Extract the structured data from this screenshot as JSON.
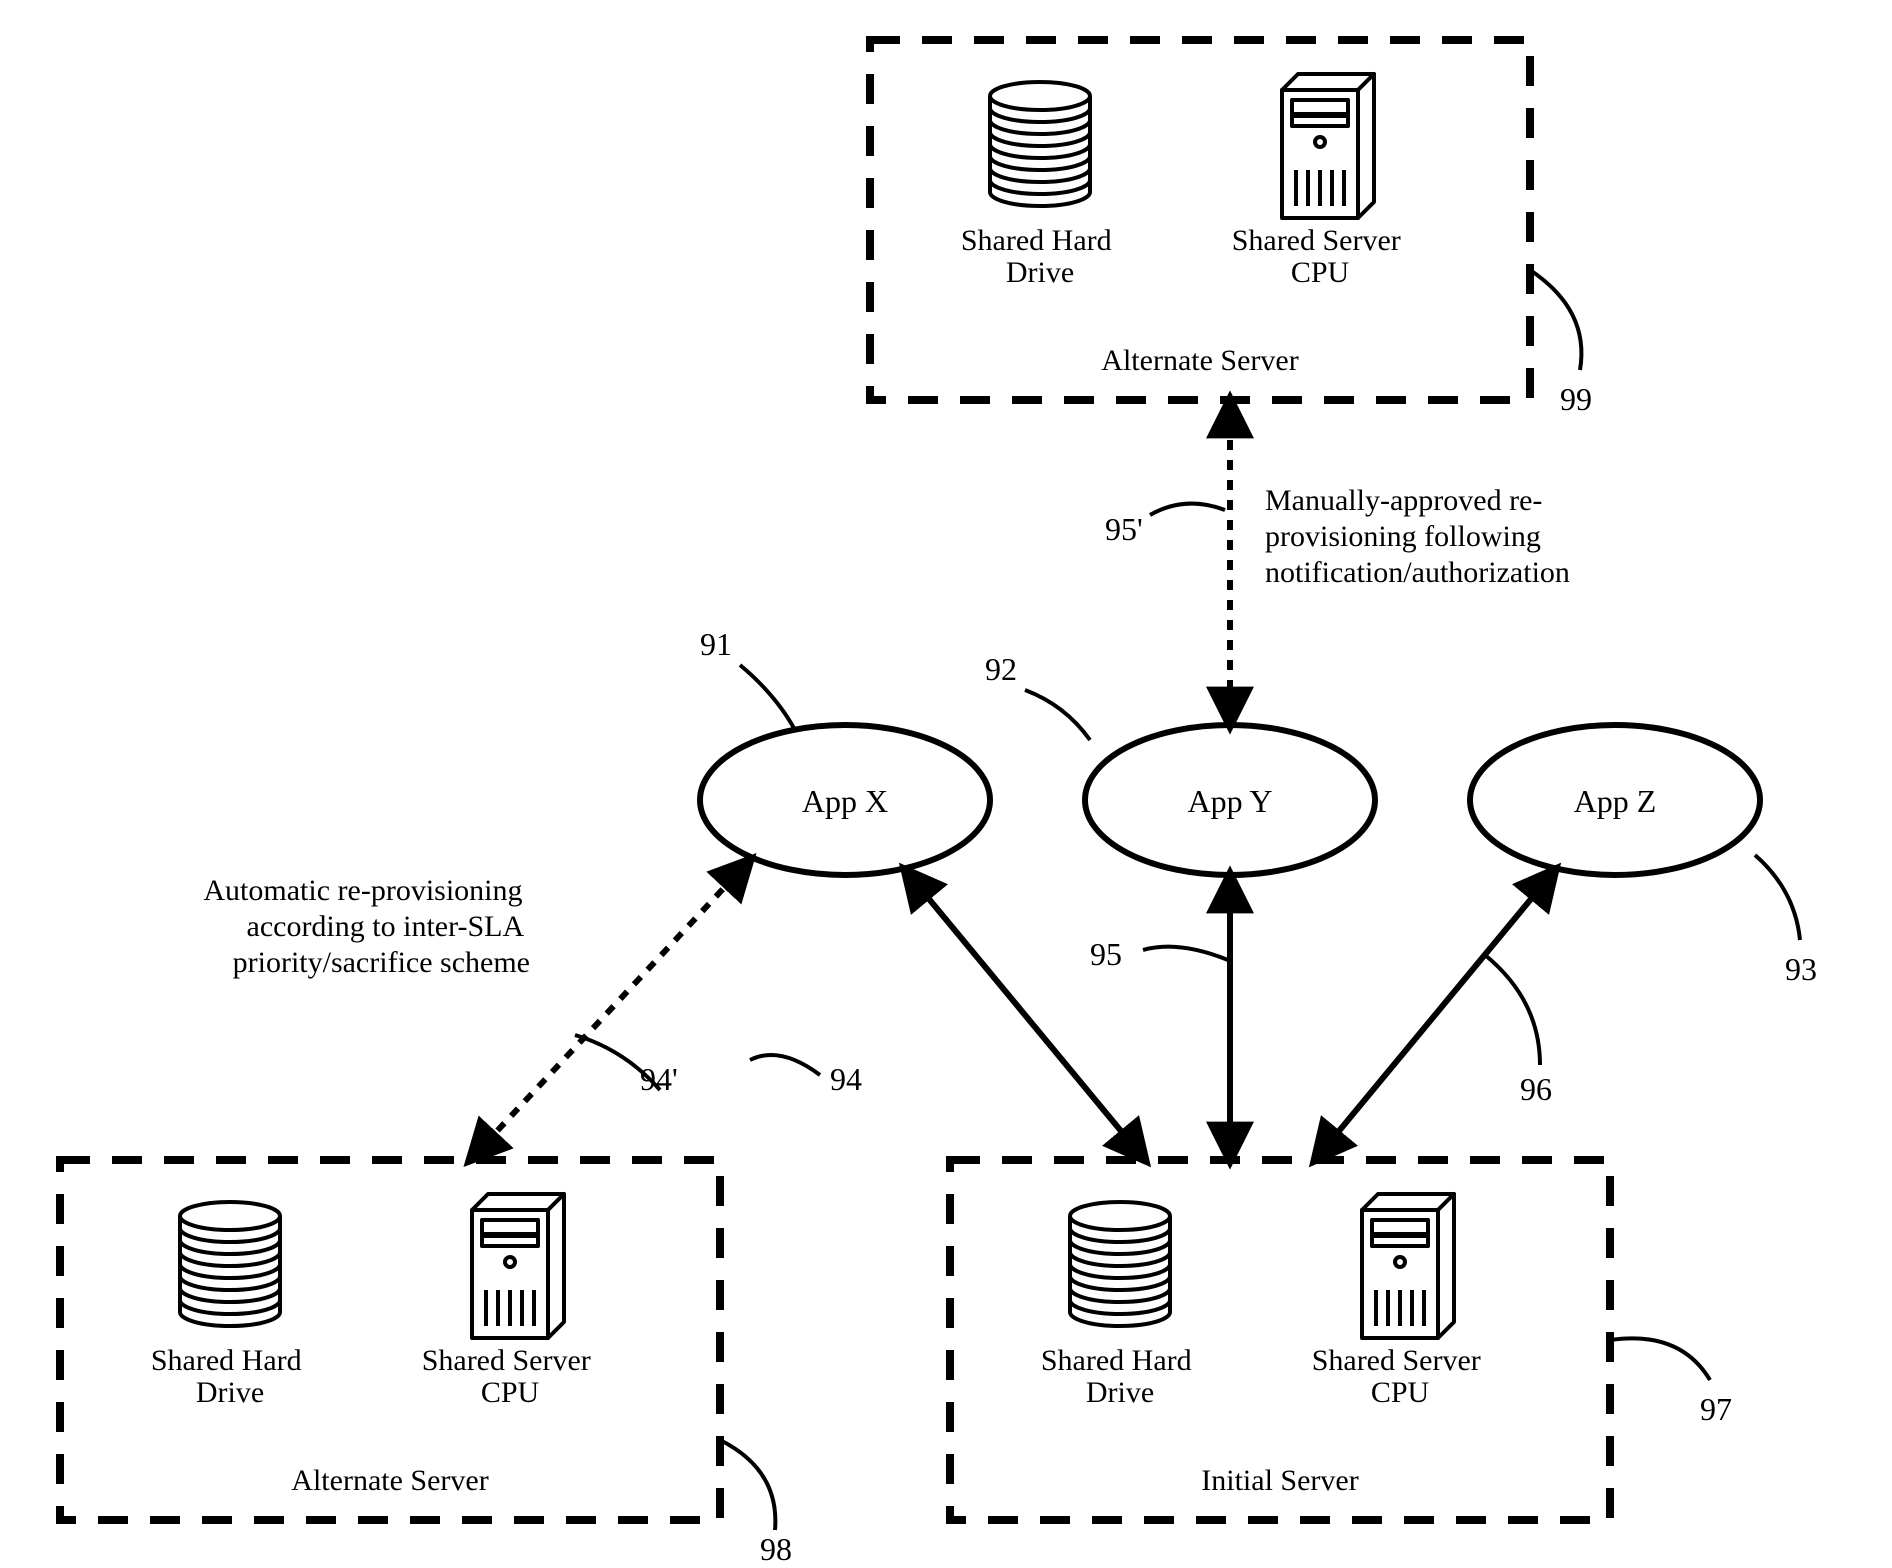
{
  "apps": {
    "x": "App X",
    "y": "App Y",
    "z": "App Z"
  },
  "servers": {
    "initial": {
      "title": "Initial Server",
      "hdd": "Shared Hard\nDrive",
      "cpu": "Shared Server\nCPU"
    },
    "alt_bottom": {
      "title": "Alternate Server",
      "hdd": "Shared Hard\nDrive",
      "cpu": "Shared Server\nCPU"
    },
    "alt_top": {
      "title": "Alternate Server",
      "hdd": "Shared Hard\nDrive",
      "cpu": "Shared Server\nCPU"
    }
  },
  "annotations": {
    "auto": "Automatic re-provisioning\naccording to inter-SLA\npriority/sacrifice scheme",
    "manual": "Manually-approved re-\nprovisioning following\nnotification/authorization"
  },
  "refs": {
    "r91": "91",
    "r92": "92",
    "r93": "93",
    "r94": "94",
    "r94p": "94'",
    "r95": "95",
    "r95p": "95'",
    "r96": "96",
    "r97": "97",
    "r98": "98",
    "r99": "99"
  }
}
